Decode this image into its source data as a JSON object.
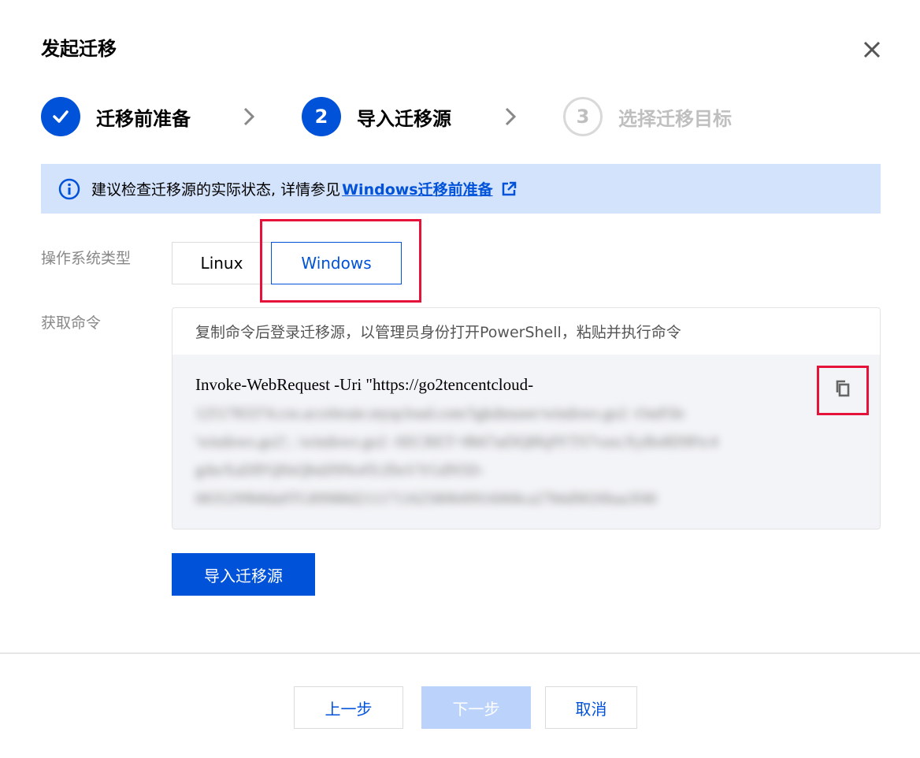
{
  "dialog": {
    "title": "发起迁移"
  },
  "steps": [
    {
      "number": "",
      "label": "迁移前准备",
      "state": "done"
    },
    {
      "number": "2",
      "label": "导入迁移源",
      "state": "active"
    },
    {
      "number": "3",
      "label": "选择迁移目标",
      "state": "todo"
    }
  ],
  "notice": {
    "text": "建议检查迁移源的实际状态, 详情参见",
    "link_label": "Windows迁移前准备"
  },
  "os_type": {
    "label": "操作系统类型",
    "options": [
      "Linux",
      "Windows"
    ],
    "selected": "Windows"
  },
  "command": {
    "label": "获取命令",
    "hint": "复制命令后登录迁移源，以管理员身份打开PowerShell，粘贴并执行命令",
    "line1": "Invoke-WebRequest -Uri \"https://go2tencentcloud-",
    "blurred_lines": [
      "1251783374.cos.accelerate.myqcloud.com/5gkdmuser/windows.go2 -OutFile",
      "'windows.go2'; .\\windows.go2 -SECRET=8b67ad3Q8fq9YTS7vaxcXyBo8D9Ftc4",
      "grkeXaDfFQHsQbidJ9Ns4TcZbsVYGdN5D-",
      "0835299b8da0TG89988d211171162580849916068ca27b6d9026baa3f40"
    ]
  },
  "import_button": {
    "label": "导入迁移源"
  },
  "footer": {
    "prev_label": "上一步",
    "next_label": "下一步",
    "cancel_label": "取消"
  },
  "colors": {
    "primary": "#0052d9",
    "notice_bg": "#d4e3fc",
    "highlight": "#e5133a",
    "disabled_button": "#bbd3fb"
  }
}
